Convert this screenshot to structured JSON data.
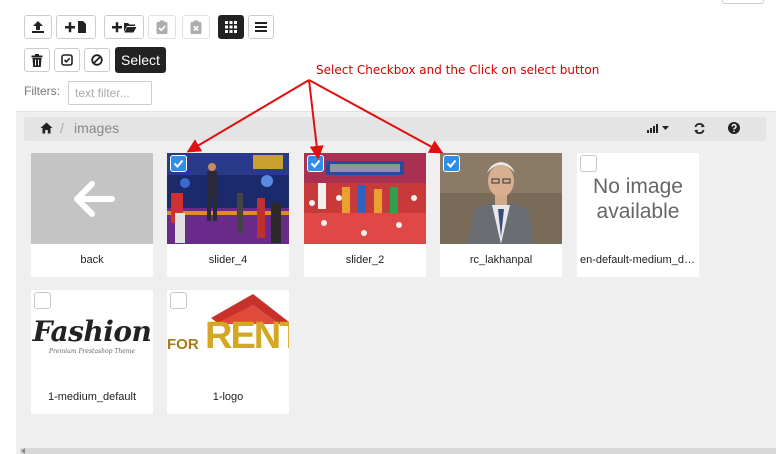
{
  "toolbar": {
    "row1": [
      {
        "name": "upload-button",
        "icon": "upload-icon"
      },
      {
        "name": "new-file-button",
        "icon": "plus-file-icon"
      },
      {
        "name": "new-folder-button",
        "icon": "plus-folder-icon"
      },
      {
        "name": "paste-button",
        "icon": "clipboard-check-icon",
        "disabled": true
      },
      {
        "name": "clear-clipboard-button",
        "icon": "clipboard-x-icon",
        "disabled": true
      },
      {
        "name": "grid-view-button",
        "icon": "grid-icon",
        "active": true
      },
      {
        "name": "list-view-button",
        "icon": "list-icon"
      }
    ],
    "row2": [
      {
        "name": "delete-button",
        "icon": "trash-icon"
      },
      {
        "name": "select-all-button",
        "icon": "check-square-icon"
      },
      {
        "name": "deselect-button",
        "icon": "ban-icon"
      }
    ],
    "select_label": "Select"
  },
  "filter": {
    "label": "Filters:",
    "placeholder": "text filter..."
  },
  "annotation": {
    "text": "Select Checkbox and the Click on select button",
    "color": "#d40000"
  },
  "breadcrumb": {
    "home_icon": "home-icon",
    "separator": "/",
    "current": "images"
  },
  "tools": {
    "sort_icon": "sort-signal-icon",
    "refresh_icon": "refresh-icon",
    "help_icon": "help-circle-icon"
  },
  "files": [
    {
      "label": "back",
      "kind": "back",
      "checked": null
    },
    {
      "label": "slider_4",
      "kind": "photo-stage",
      "checked": true
    },
    {
      "label": "slider_2",
      "kind": "photo-dance",
      "checked": true
    },
    {
      "label": "rc_lakhanpal",
      "kind": "photo-portrait",
      "checked": true
    },
    {
      "label": "en-default-medium_default",
      "kind": "no-image",
      "checked": false,
      "image_text": [
        "No image",
        "available"
      ]
    },
    {
      "label": "1-medium_default",
      "kind": "fashion",
      "checked": false,
      "image_text": [
        "Fashion",
        "Premium Prestashop Theme"
      ]
    },
    {
      "label": "1-logo",
      "kind": "for-rent",
      "checked": false,
      "image_text": [
        "FOR",
        "RENT"
      ]
    }
  ],
  "colors": {
    "checkbox_checked": "#2f8fe8",
    "dark_button": "#222222",
    "panel_bg": "#efefef"
  }
}
